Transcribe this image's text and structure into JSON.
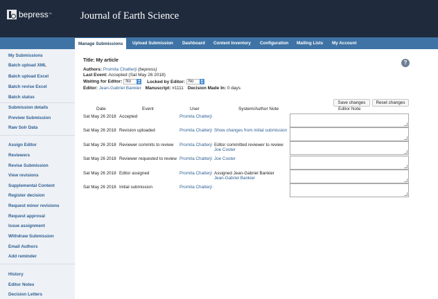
{
  "header": {
    "logo_text": "bepress",
    "logo_tm": "™",
    "journal_title": "Journal of Earth Science"
  },
  "nav": {
    "tabs": [
      {
        "label": "Manage Submissions",
        "active": true
      },
      {
        "label": "Upload Submission",
        "active": false
      },
      {
        "label": "Dashboard",
        "active": false
      },
      {
        "label": "Content Inventory",
        "active": false
      },
      {
        "label": "Configuration",
        "active": false
      },
      {
        "label": "Mailing Lists",
        "active": false
      },
      {
        "label": "My Account",
        "active": false
      }
    ]
  },
  "sidebar": {
    "items": [
      "My Submissions",
      "Batch upload XML",
      "Batch upload Excel",
      "Batch revise Excel",
      "Batch status",
      "Submission details",
      "Preview Submission",
      "Raw Solr Data",
      "Assign Editor",
      "Reviewers",
      "Revise Submission",
      "View revisions",
      "Supplemental Content",
      "Register decision",
      "Request minor revisions",
      "Request approval",
      "Issue assignment",
      "Withdraw Submission",
      "Email Authors",
      "Add reminder",
      "History",
      "Editor Notes",
      "Decision Letters"
    ]
  },
  "article": {
    "title_label": "Title:",
    "title_value": "My article",
    "authors_label": "Authors:",
    "author_name": "Promita Chatterji",
    "author_affil": "(bepress)",
    "last_event_label": "Last Event:",
    "last_event_value": "Accepted (Sat May 26 2018)",
    "waiting_label": "Waiting for Editor:",
    "waiting_value": "No",
    "locked_label": "Locked by Editor:",
    "locked_value": "No",
    "editor_label": "Editor:",
    "editor_name": "Jean-Gabriel Bankier",
    "manuscript_label": "Manuscript:",
    "manuscript_value": "#1111",
    "decision_label": "Decision Made In:",
    "decision_value": "0 days"
  },
  "buttons": {
    "save": "Save changes",
    "reset": "Reset changes"
  },
  "help_icon": "?",
  "history_table": {
    "columns": [
      "Date",
      "Event",
      "User",
      "System/Author Note",
      "Editor Note"
    ],
    "rows": [
      {
        "date": "Sat May 26 2018",
        "event": "Accepted",
        "user": "Promita Chatterji",
        "note": "",
        "note2": ""
      },
      {
        "date": "Sat May 26 2018",
        "event": "Revision uploaded",
        "user": "Promita Chatterji",
        "note": "Show changes from initial submission",
        "note2": ""
      },
      {
        "date": "Sat May 26 2018",
        "event": "Reviewer commits to review",
        "user": "Promita Chatterji",
        "note": "Editor committed reviewer to review",
        "note2": "Joe Cooter"
      },
      {
        "date": "Sat May 26 2018",
        "event": "Reviewer requested to review",
        "user": "Promita Chatterji",
        "note": "Joe Cooter",
        "note2": ""
      },
      {
        "date": "Sat May 26 2018",
        "event": "Editor assigned",
        "user": "Promita Chatterji",
        "note": "Assigned Jean-Gabriel Bankier",
        "note2": "Jean-Gabriel Bankier"
      },
      {
        "date": "Sat May 26 2018",
        "event": "Initial submission",
        "user": "Promita Chatterji",
        "note": "",
        "note2": ""
      }
    ]
  }
}
